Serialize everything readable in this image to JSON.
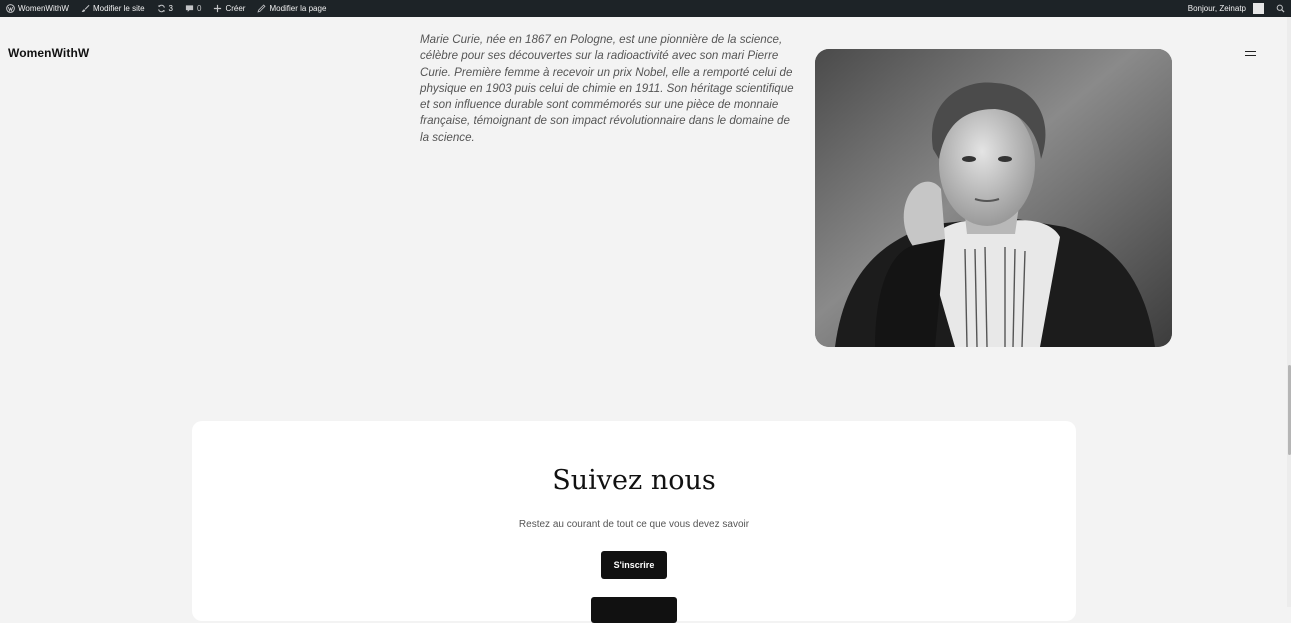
{
  "admin_bar": {
    "site_name": "WomenWithW",
    "edit_site": "Modifier le site",
    "updates_count": "3",
    "comments_count": "0",
    "create": "Créer",
    "edit_page": "Modifier la page",
    "greeting": "Bonjour, Zeinatp"
  },
  "header": {
    "site_title": "WomenWithW"
  },
  "bio": {
    "text": "Marie Curie, née en 1867 en Pologne, est une pionnière de la science, célèbre pour ses découvertes sur la radioactivité avec son mari Pierre Curie. Première femme à recevoir un prix Nobel, elle a remporté celui de physique en 1903 puis celui de chimie en 1911. Son héritage scientifique et son influence durable sont commémorés sur une pièce de monnaie française, témoignant de son impact révolutionnaire dans le domaine de la science."
  },
  "follow": {
    "title": "Suivez nous",
    "subtitle": "Restez au courant de tout ce que vous devez savoir",
    "subscribe_label": "S'inscrire"
  },
  "icons": {
    "wp": "wordpress-logo-icon",
    "brush": "customize-brush-icon",
    "updates": "updates-icon",
    "comments": "comment-icon",
    "plus": "plus-icon",
    "pencil": "pencil-icon",
    "search": "search-icon",
    "menu": "hamburger-menu-icon"
  },
  "colors": {
    "admin_bar_bg": "#1d2327",
    "page_bg": "#f3f3f3",
    "button_bg": "#111111"
  }
}
